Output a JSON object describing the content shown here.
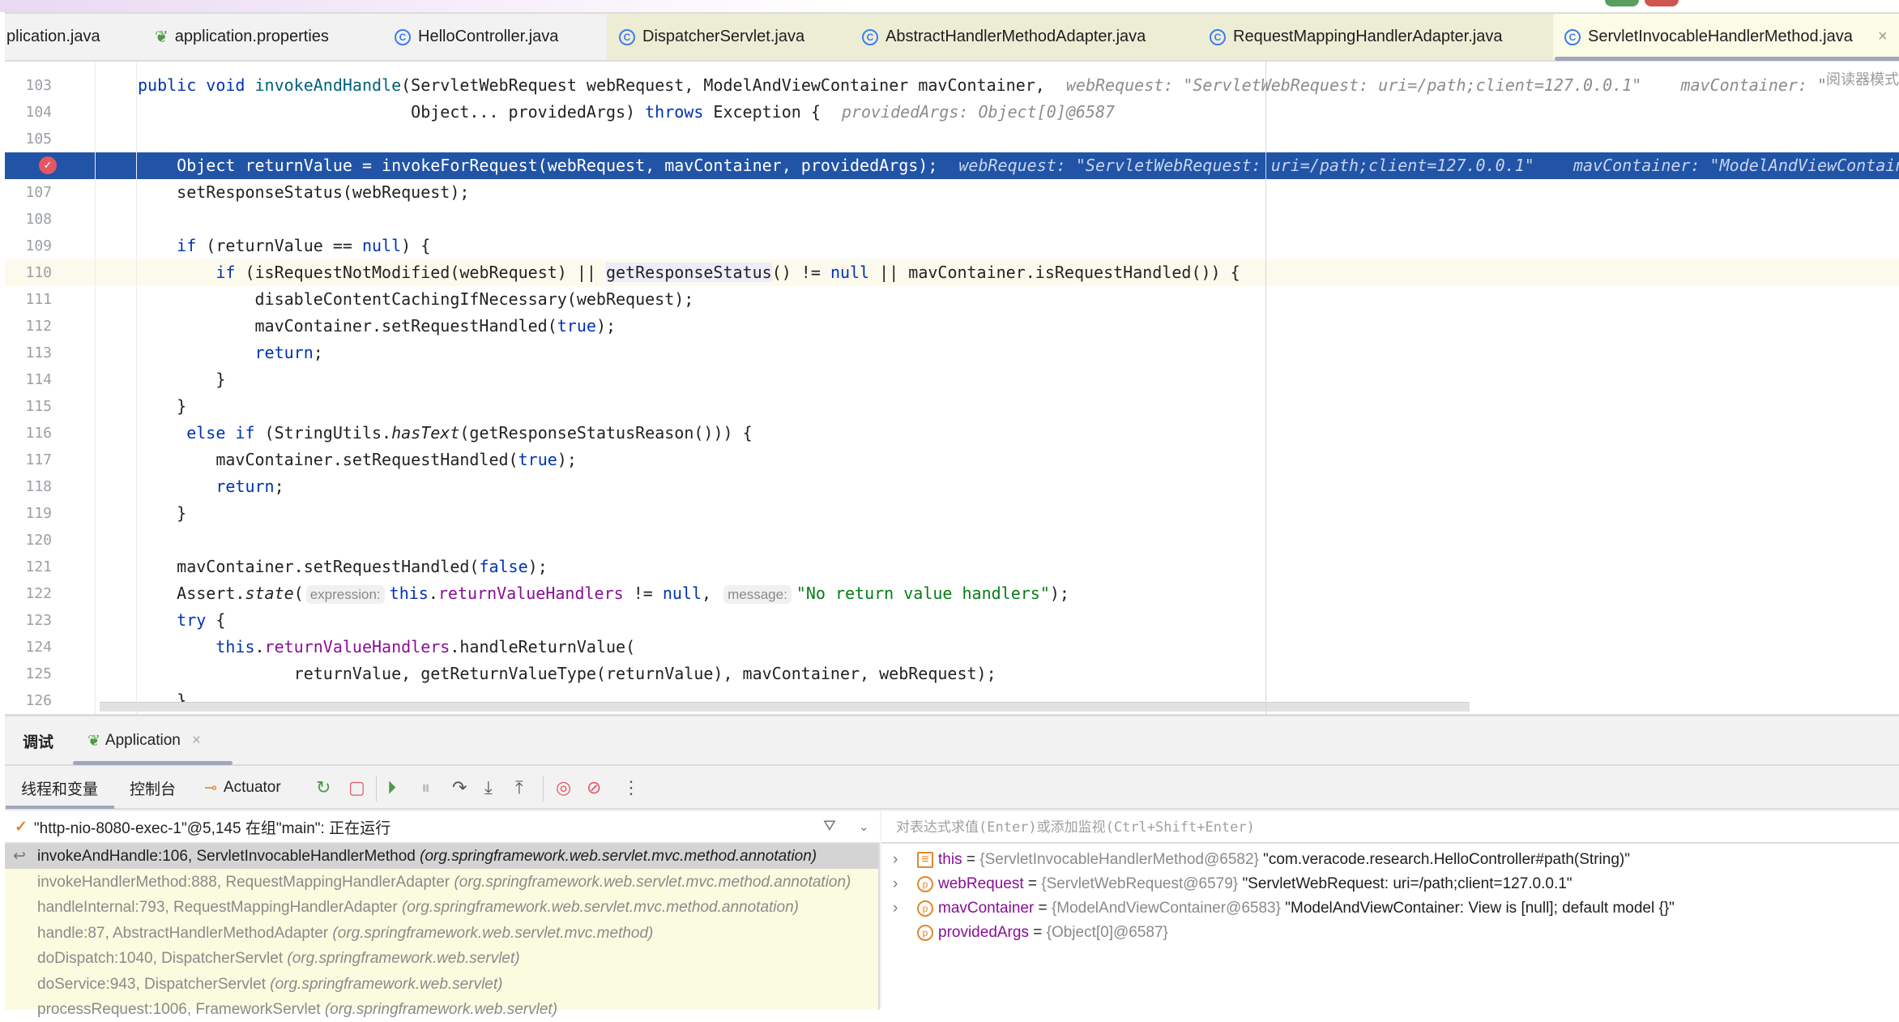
{
  "colors": {
    "accent": "#2154a6",
    "breakpoint": "#e55765",
    "keyword": "#0033b3",
    "string": "#067d17",
    "field": "#871094"
  },
  "tabs": [
    {
      "label": "plication.java",
      "icon": "none"
    },
    {
      "label": "application.properties",
      "icon": "spring-leaf-icon"
    },
    {
      "label": "HelloController.java",
      "icon": "class-icon"
    },
    {
      "label": "DispatcherServlet.java",
      "icon": "class-icon"
    },
    {
      "label": "AbstractHandlerMethodAdapter.java",
      "icon": "class-icon"
    },
    {
      "label": "RequestMappingHandlerAdapter.java",
      "icon": "class-icon"
    },
    {
      "label": "ServletInvocableHandlerMethod.java",
      "icon": "class-icon",
      "active": true
    }
  ],
  "tab_close": "×",
  "reader_mode": "阅读器模式",
  "editor": {
    "execution_line": 106,
    "current_line": 110,
    "lines": [
      {
        "n": "103",
        "t": [
          [
            "public",
            "kw"
          ],
          [
            " ",
            ""
          ],
          [
            "void",
            "kw"
          ],
          [
            " ",
            ""
          ],
          [
            "invokeAndHandle",
            "fn"
          ],
          [
            "(ServletWebRequest webRequest, ModelAndViewContainer mavContainer,",
            ""
          ]
        ],
        "hint": "webRequest: \"ServletWebRequest: uri=/path;client=127.0.0.1\"    mavContainer: \""
      },
      {
        "n": "104",
        "t": [
          [
            "                            Object... providedArgs) ",
            ""
          ],
          [
            "throws",
            "kw"
          ],
          [
            " Exception {",
            ""
          ]
        ],
        "hint": "providedArgs: Object[0]@6587"
      },
      {
        "n": "105",
        "t": []
      },
      {
        "n": "106",
        "t": [
          [
            "    Object returnValue = invokeForRequest(webRequest, mavContainer, providedArgs);",
            ""
          ]
        ],
        "hint": "webRequest: \"ServletWebRequest: uri=/path;client=127.0.0.1\"    mavContainer: \"ModelAndViewContainer: View is [null]; default model {}\""
      },
      {
        "n": "107",
        "t": [
          [
            "    setResponseStatus(webRequest);",
            ""
          ]
        ]
      },
      {
        "n": "108",
        "t": []
      },
      {
        "n": "109",
        "t": [
          [
            "    ",
            ""
          ],
          [
            "if",
            "kw"
          ],
          [
            " (returnValue == ",
            ""
          ],
          [
            "null",
            "kw"
          ],
          [
            ") {",
            ""
          ]
        ]
      },
      {
        "n": "110",
        "t": [
          [
            "        ",
            ""
          ],
          [
            "if",
            "kw"
          ],
          [
            " (isRequestNotModified(webRequest) || ",
            ""
          ],
          [
            "getResponseStatus",
            "hl"
          ],
          [
            "() != ",
            ""
          ],
          [
            "null",
            "kw"
          ],
          [
            " || mavContainer.isRequestHandled()) {",
            ""
          ]
        ]
      },
      {
        "n": "111",
        "t": [
          [
            "            disableContentCachingIfNecessary(webRequest);",
            ""
          ]
        ]
      },
      {
        "n": "112",
        "t": [
          [
            "            mavContainer.setRequestHandled(",
            ""
          ],
          [
            "true",
            "kw"
          ],
          [
            ");",
            ""
          ]
        ]
      },
      {
        "n": "113",
        "t": [
          [
            "            ",
            ""
          ],
          [
            "return",
            "kw"
          ],
          [
            ";",
            ""
          ]
        ]
      },
      {
        "n": "114",
        "t": [
          [
            "        }",
            ""
          ]
        ]
      },
      {
        "n": "115",
        "t": [
          [
            "    }",
            ""
          ]
        ]
      },
      {
        "n": "116",
        "t": [
          [
            "     ",
            ""
          ],
          [
            "else if",
            "kw"
          ],
          [
            " (StringUtils.",
            ""
          ],
          [
            "hasText",
            "it"
          ],
          [
            "(getResponseStatusReason())) {",
            ""
          ]
        ]
      },
      {
        "n": "117",
        "t": [
          [
            "        mavContainer.setRequestHandled(",
            ""
          ],
          [
            "true",
            "kw"
          ],
          [
            ");",
            ""
          ]
        ]
      },
      {
        "n": "118",
        "t": [
          [
            "        ",
            ""
          ],
          [
            "return",
            "kw"
          ],
          [
            ";",
            ""
          ]
        ]
      },
      {
        "n": "119",
        "t": [
          [
            "    }",
            ""
          ]
        ]
      },
      {
        "n": "120",
        "t": []
      },
      {
        "n": "121",
        "t": [
          [
            "    mavContainer.setRequestHandled(",
            ""
          ],
          [
            "false",
            "kw"
          ],
          [
            ");",
            ""
          ]
        ]
      },
      {
        "n": "122",
        "t": [
          [
            "    Assert.",
            ""
          ],
          [
            "state",
            "it"
          ],
          [
            "(",
            ""
          ],
          [
            "expression:",
            "chip"
          ],
          [
            "this",
            "kw"
          ],
          [
            ".",
            ""
          ],
          [
            "returnValueHandlers",
            "fld"
          ],
          [
            " != ",
            ""
          ],
          [
            "null",
            "kw"
          ],
          [
            ", ",
            ""
          ],
          [
            "message:",
            "chip"
          ],
          [
            "\"No return value handlers\"",
            "str"
          ],
          [
            ");",
            ""
          ]
        ]
      },
      {
        "n": "123",
        "t": [
          [
            "    ",
            ""
          ],
          [
            "try",
            "kw"
          ],
          [
            " {",
            ""
          ]
        ]
      },
      {
        "n": "124",
        "t": [
          [
            "        ",
            ""
          ],
          [
            "this",
            "kw"
          ],
          [
            ".",
            ""
          ],
          [
            "returnValueHandlers",
            "fld"
          ],
          [
            ".handleReturnValue(",
            ""
          ]
        ]
      },
      {
        "n": "125",
        "t": [
          [
            "                returnValue, getReturnValueType(returnValue), mavContainer, webRequest);",
            ""
          ]
        ]
      },
      {
        "n": "126",
        "t": [
          [
            "    }",
            ""
          ]
        ]
      }
    ]
  },
  "debug": {
    "title": "调试",
    "session_tab": "Application",
    "toolbar": {
      "threads_vars": "线程和变量",
      "console": "控制台",
      "actuator": "Actuator"
    },
    "thread": "\"http-nio-8080-exec-1\"@5,145 在组\"main\": 正在运行",
    "frames": [
      {
        "method": "invokeAndHandle:106, ServletInvocableHandlerMethod",
        "pkg": "(org.springframework.web.servlet.mvc.method.annotation)",
        "selected": true
      },
      {
        "method": "invokeHandlerMethod:888, RequestMappingHandlerAdapter",
        "pkg": "(org.springframework.web.servlet.mvc.method.annotation)"
      },
      {
        "method": "handleInternal:793, RequestMappingHandlerAdapter",
        "pkg": "(org.springframework.web.servlet.mvc.method.annotation)"
      },
      {
        "method": "handle:87, AbstractHandlerMethodAdapter",
        "pkg": "(org.springframework.web.servlet.mvc.method)"
      },
      {
        "method": "doDispatch:1040, DispatcherServlet",
        "pkg": "(org.springframework.web.servlet)"
      },
      {
        "method": "doService:943, DispatcherServlet",
        "pkg": "(org.springframework.web.servlet)"
      },
      {
        "method": "processRequest:1006, FrameworkServlet",
        "pkg": "(org.springframework.web.servlet)"
      }
    ],
    "eval_placeholder": "对表达式求值(Enter)或添加监视(Ctrl+Shift+Enter)",
    "variables": [
      {
        "name": "this",
        "type": "{ServletInvocableHandlerMethod@6582}",
        "value": "\"com.veracode.research.HelloController#path(String)\"",
        "expandable": true,
        "icon": "field-list-icon"
      },
      {
        "name": "webRequest",
        "type": "{ServletWebRequest@6579}",
        "value": "\"ServletWebRequest: uri=/path;client=127.0.0.1\"",
        "expandable": true,
        "icon": "parameter-icon"
      },
      {
        "name": "mavContainer",
        "type": "{ModelAndViewContainer@6583}",
        "value": "\"ModelAndViewContainer: View is [null]; default model {}\"",
        "expandable": true,
        "icon": "parameter-icon"
      },
      {
        "name": "providedArgs",
        "type": "{Object[0]@6587}",
        "value": "",
        "expandable": false,
        "icon": "parameter-icon"
      }
    ]
  }
}
